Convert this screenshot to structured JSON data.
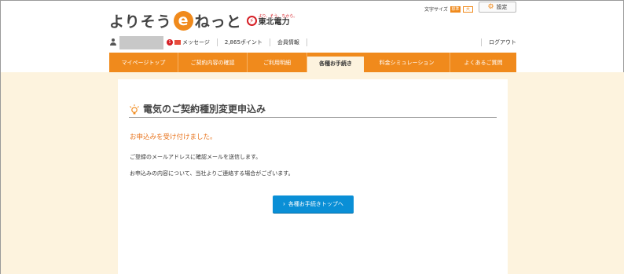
{
  "header": {
    "logo_text_pre": "よりそう",
    "logo_e": "e",
    "logo_text_post": "ねっと",
    "company_small": "より、そう、ちから。",
    "company_name": "東北電力",
    "fontsize_label": "文字サイズ",
    "fontsize_large": "大",
    "fontsize_standard": "標準",
    "settings_label": "設定"
  },
  "userbar": {
    "message_badge": "1",
    "message_label": "メッセージ",
    "points_label": "2,865ポイント",
    "member_label": "会員情報",
    "logout_label": "ログアウト"
  },
  "nav": {
    "items": [
      {
        "label": "マイページトップ"
      },
      {
        "label": "ご契約内容の確認"
      },
      {
        "label": "ご利用明細"
      },
      {
        "label": "各種お手続き"
      },
      {
        "label": "料金シミュレーション"
      },
      {
        "label": "よくあるご質問"
      }
    ],
    "active_index": 3
  },
  "main": {
    "title": "電気のご契約種別変更申込み",
    "success_message": "お申込みを受け付けました。",
    "info_line1": "ご登録のメールアドレスに確認メールを送信します。",
    "info_line2": "お申込みの内容について、当社よりご連絡する場合がございます。",
    "button_label": "各種お手続きトップへ"
  },
  "colors": {
    "accent": "#f08a1c",
    "button": "#0a8fd6",
    "background": "#fdf3de",
    "success_text": "#e8731c"
  }
}
